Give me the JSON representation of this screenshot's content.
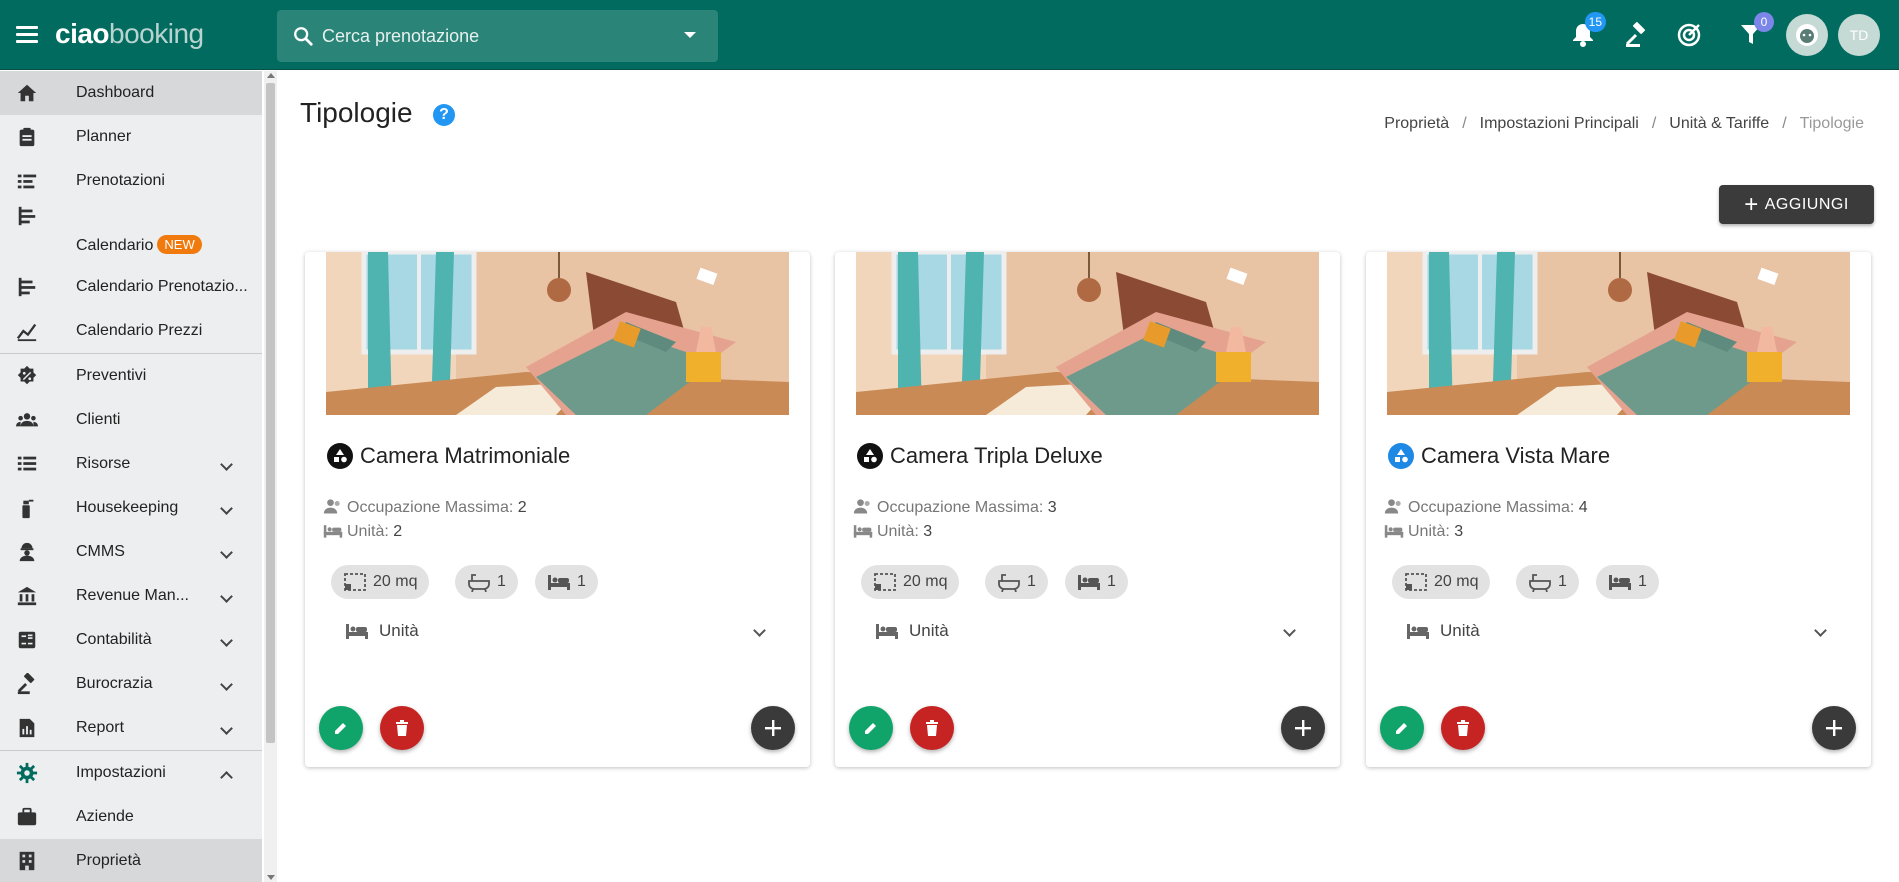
{
  "app": {
    "logo_bold": "ciao",
    "logo_light": "booking",
    "search_placeholder": "Cerca prenotazione",
    "notifications_count": "15",
    "filter_count": "0",
    "user_initials": "TD"
  },
  "sidebar": {
    "items": [
      {
        "label": "Dashboard",
        "icon": "home-icon"
      },
      {
        "label": "Planner",
        "icon": "clipboard-icon"
      },
      {
        "label": "Prenotazioni",
        "icon": "list-icon"
      },
      {
        "label": "Calendario",
        "badge": "NEW",
        "icon": "calendar-bars-icon"
      },
      {
        "label": "Calendario Prenotazio...",
        "icon": "calendar-bars-icon"
      },
      {
        "label": "Calendario Prezzi",
        "icon": "chart-icon"
      },
      {
        "label": "Preventivi",
        "icon": "percent-icon"
      },
      {
        "label": "Clienti",
        "icon": "people-icon"
      },
      {
        "label": "Risorse",
        "icon": "list-icon"
      },
      {
        "label": "Housekeeping",
        "icon": "spray-icon"
      },
      {
        "label": "CMMS",
        "icon": "worker-icon"
      },
      {
        "label": "Revenue Man...",
        "icon": "bank-icon"
      },
      {
        "label": "Contabilità",
        "icon": "calculator-icon"
      },
      {
        "label": "Burocrazia",
        "icon": "gavel-icon"
      },
      {
        "label": "Report",
        "icon": "report-icon"
      },
      {
        "label": "Impostazioni",
        "icon": "gear-icon"
      },
      {
        "label": "Aziende",
        "icon": "briefcase-icon"
      },
      {
        "label": "Proprietà",
        "icon": "building-icon"
      }
    ]
  },
  "page": {
    "title": "Tipologie",
    "breadcrumb": [
      "Proprietà",
      "Impostazioni Principali",
      "Unità & Tariffe",
      "Tipologie"
    ],
    "add_label": "AGGIUNGI"
  },
  "cards": [
    {
      "title": "Camera Matrimoniale",
      "occupancy_label": "Occupazione Massima:",
      "occupancy": "2",
      "units_label": "Unità:",
      "units": "2",
      "size": "20 mq",
      "baths": "1",
      "beds": "1",
      "units_section": "Unità",
      "icon_color": "#111111"
    },
    {
      "title": "Camera Tripla Deluxe",
      "occupancy_label": "Occupazione Massima:",
      "occupancy": "3",
      "units_label": "Unità:",
      "units": "3",
      "size": "20 mq",
      "baths": "1",
      "beds": "1",
      "units_section": "Unità",
      "icon_color": "#111111"
    },
    {
      "title": "Camera Vista Mare",
      "occupancy_label": "Occupazione Massima:",
      "occupancy": "4",
      "units_label": "Unità:",
      "units": "3",
      "size": "20 mq",
      "baths": "1",
      "beds": "1",
      "units_section": "Unità",
      "icon_color": "#1e88e5"
    }
  ],
  "colors": {
    "topbar": "#006b5e",
    "accent_green": "#10a36a",
    "danger_red": "#c62323",
    "badge_blue": "#2196f3",
    "badge_purple": "#7b86e8",
    "new_orange": "#f07a0e"
  }
}
